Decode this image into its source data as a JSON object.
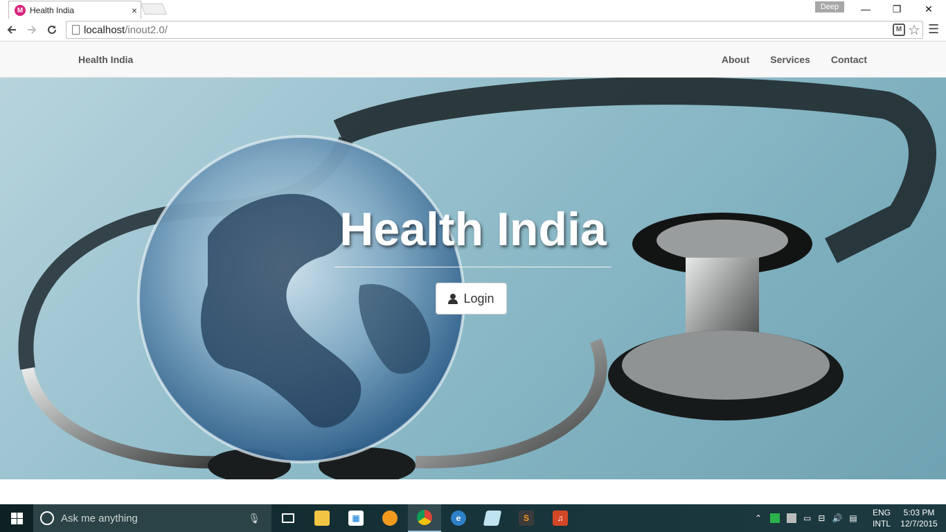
{
  "browser": {
    "tab_title": "Health India",
    "tab_close": "×",
    "favicon_letter": "M",
    "profile_name": "Deep",
    "url_host": "localhost",
    "url_path": "/inout2.0/",
    "win_minimize": "—",
    "win_restore": "❐",
    "win_close": "✕"
  },
  "navbar": {
    "brand": "Health India",
    "links": [
      "About",
      "Services",
      "Contact"
    ]
  },
  "hero": {
    "title": "Health India",
    "login_label": "Login"
  },
  "taskbar": {
    "search_placeholder": "Ask me anything",
    "lang_top": "ENG",
    "lang_bottom": "INTL",
    "time": "5:03 PM",
    "date": "12/7/2015"
  },
  "colors": {
    "favicon": "#d6247b",
    "navbar_bg": "#f8f8f8",
    "hero_bg": "#95bfcc",
    "taskbar_bg": "#17343a"
  }
}
